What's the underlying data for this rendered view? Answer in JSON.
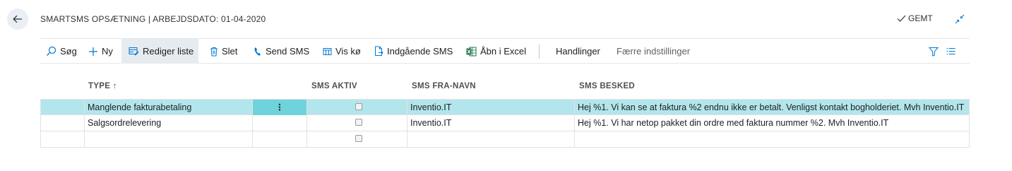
{
  "header": {
    "title": "SMARTSMS OPSÆTNING | ARBEJDSDATO: 01-04-2020",
    "saved_label": "GEMT"
  },
  "actions": {
    "search": "Søg",
    "new": "Ny",
    "edit_list": "Rediger liste",
    "delete": "Slet",
    "send_sms": "Send SMS",
    "show_queue": "Vis kø",
    "incoming_sms": "Indgående SMS",
    "open_excel": "Åbn i Excel",
    "actions_menu": "Handlinger",
    "fewer_options": "Færre indstillinger"
  },
  "table": {
    "columns": {
      "type": "TYPE ↑",
      "sms_active": "SMS AKTIV",
      "sms_from": "SMS FRA-NAVN",
      "sms_message": "SMS BESKED"
    },
    "rows": [
      {
        "type": "Manglende fakturabetaling",
        "row_menu": "⋮",
        "sms_active": false,
        "sms_from": "Inventio.IT",
        "sms_message": "Hej %1. Vi kan se at faktura %2 endnu ikke er betalt. Venligst kontakt bogholderiet. Mvh Inventio.IT"
      },
      {
        "type": "Salgsordrelevering",
        "row_menu": "",
        "sms_active": false,
        "sms_from": "Inventio.IT",
        "sms_message": "Hej %1. Vi har netop pakket din ordre med faktura nummer %2. Mvh Inventio.IT"
      },
      {
        "type": "",
        "row_menu": "",
        "sms_active": false,
        "sms_from": "",
        "sms_message": ""
      }
    ]
  },
  "colors": {
    "accent": "#0078d4",
    "selected_row": "#b2e6ec",
    "selected_menu": "#6fd3dc",
    "excel_green": "#1e7145"
  },
  "icons": [
    "back-arrow-icon",
    "check-icon",
    "collapse-icon",
    "search-icon",
    "plus-icon",
    "edit-list-icon",
    "trash-icon",
    "phone-icon",
    "queue-icon",
    "incoming-doc-icon",
    "excel-icon",
    "filter-icon",
    "list-view-icon"
  ]
}
